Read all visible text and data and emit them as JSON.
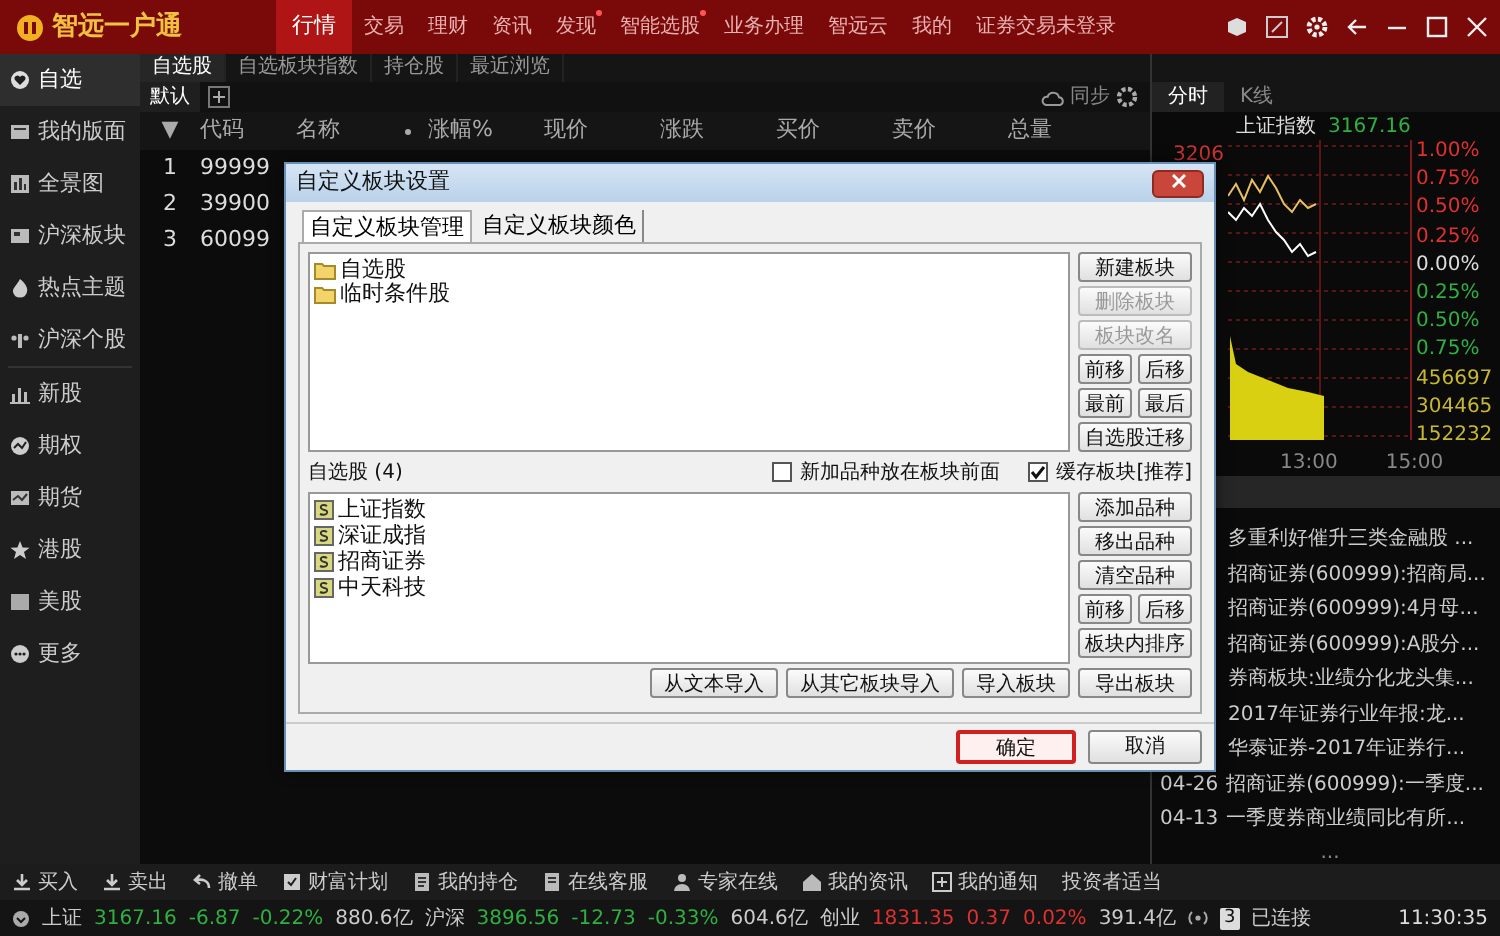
{
  "app": {
    "logo": "智远一户通"
  },
  "top_nav": [
    {
      "label": "行情",
      "selected": true,
      "dot": false
    },
    {
      "label": "交易",
      "selected": false,
      "dot": false
    },
    {
      "label": "理财",
      "selected": false,
      "dot": false
    },
    {
      "label": "资讯",
      "selected": false,
      "dot": false
    },
    {
      "label": "发现",
      "selected": false,
      "dot": true
    },
    {
      "label": "智能选股",
      "selected": false,
      "dot": true
    },
    {
      "label": "业务办理",
      "selected": false,
      "dot": false
    },
    {
      "label": "智远云",
      "selected": false,
      "dot": false
    },
    {
      "label": "我的",
      "selected": false,
      "dot": false
    }
  ],
  "login_status": "证券交易未登录",
  "sidebar": [
    {
      "label": "自选",
      "selected": true
    },
    {
      "label": "我的版面",
      "selected": false
    },
    {
      "label": "全景图",
      "selected": false
    },
    {
      "label": "沪深板块",
      "selected": false
    },
    {
      "label": "热点主题",
      "selected": false
    },
    {
      "label": "沪深个股",
      "selected": false
    },
    {
      "label": "新股",
      "selected": false
    },
    {
      "label": "期权",
      "selected": false
    },
    {
      "label": "期货",
      "selected": false
    },
    {
      "label": "港股",
      "selected": false
    },
    {
      "label": "美股",
      "selected": false
    },
    {
      "label": "更多",
      "selected": false
    }
  ],
  "subtabs": [
    {
      "label": "自选股",
      "selected": true
    },
    {
      "label": "自选板块指数",
      "selected": false
    },
    {
      "label": "持仓股",
      "selected": false
    },
    {
      "label": "最近浏览",
      "selected": false
    }
  ],
  "group_tabs": [
    {
      "label": "默认",
      "selected": true
    }
  ],
  "sync_label": "同步",
  "table": {
    "sort_marker": "▼",
    "columns": [
      "代码",
      "名称",
      "涨幅%",
      "现价",
      "涨跌",
      "买价",
      "卖价",
      "总量"
    ],
    "rows": [
      {
        "index": "1",
        "code": "99999"
      },
      {
        "index": "2",
        "code": "39900"
      },
      {
        "index": "3",
        "code": "60099"
      }
    ]
  },
  "right_panel": {
    "tabs": [
      {
        "label": "分时",
        "selected": true
      },
      {
        "label": "K线",
        "selected": false
      }
    ],
    "chart": {
      "title": "上证指数",
      "price": "3167.16",
      "left_labels": [
        "3206"
      ],
      "right_labels": [
        {
          "text": "1.00%",
          "kind": "up"
        },
        {
          "text": "0.75%",
          "kind": "up"
        },
        {
          "text": "0.50%",
          "kind": "up"
        },
        {
          "text": "0.25%",
          "kind": "up"
        },
        {
          "text": "0.00%",
          "kind": "flat"
        },
        {
          "text": "0.25%",
          "kind": "down"
        },
        {
          "text": "0.50%",
          "kind": "down"
        },
        {
          "text": "0.75%",
          "kind": "down"
        },
        {
          "text": "456697",
          "kind": "volume"
        },
        {
          "text": "304465",
          "kind": "volume"
        },
        {
          "text": "152232",
          "kind": "volume"
        }
      ],
      "time_labels": [
        "13:00",
        "15:00"
      ]
    },
    "news": [
      {
        "title": "多重利好催升三类金融股 ..."
      },
      {
        "title": "招商证券(600999):招商局..."
      },
      {
        "title": "招商证券(600999):4月母..."
      },
      {
        "title": "招商证券(600999):A股分..."
      },
      {
        "title": "券商板块:业绩分化龙头集..."
      },
      {
        "title": "2017年证券行业年报:龙..."
      },
      {
        "title": "华泰证券-2017年证券行..."
      },
      {
        "date": "04-26",
        "title": "招商证券(600999):一季度..."
      },
      {
        "date": "04-13",
        "title": "一季度券商业绩同比有所..."
      }
    ],
    "news_more": "..."
  },
  "toolbar": [
    "买入",
    "卖出",
    "撤单",
    "财富计划",
    "我的持仓",
    "在线客服",
    "专家在线",
    "我的资讯",
    "我的通知",
    "投资者适当"
  ],
  "status_bar": {
    "quotes": [
      {
        "text": "上证",
        "kind": "label"
      },
      {
        "text": "3167.16",
        "kind": "down"
      },
      {
        "text": "-6.87",
        "kind": "down"
      },
      {
        "text": "-0.22%",
        "kind": "down"
      },
      {
        "text": "880.6亿",
        "kind": "plain"
      },
      {
        "text": "沪深",
        "kind": "label"
      },
      {
        "text": "3896.56",
        "kind": "down"
      },
      {
        "text": "-12.73",
        "kind": "down"
      },
      {
        "text": "-0.33%",
        "kind": "down"
      },
      {
        "text": "604.6亿",
        "kind": "plain"
      },
      {
        "text": "创业",
        "kind": "label"
      },
      {
        "text": "1831.35",
        "kind": "up"
      },
      {
        "text": "0.37",
        "kind": "up"
      },
      {
        "text": "0.02%",
        "kind": "up"
      },
      {
        "text": "391.4亿",
        "kind": "plain"
      }
    ],
    "connections": "3",
    "connection_status": "已连接",
    "time": "11:30:35"
  },
  "dialog": {
    "title": "自定义板块设置",
    "tabs": [
      {
        "label": "自定义板块管理",
        "selected": true
      },
      {
        "label": "自定义板块颜色",
        "selected": false
      }
    ],
    "blocks": [
      "自选股",
      "临时条件股"
    ],
    "block_button_rows": [
      [
        {
          "label": "新建板块",
          "disabled": false
        }
      ],
      [
        {
          "label": "删除板块",
          "disabled": true
        }
      ],
      [
        {
          "label": "板块改名",
          "disabled": true
        }
      ],
      [
        {
          "label": "前移",
          "disabled": false
        },
        {
          "label": "后移",
          "disabled": false
        }
      ],
      [
        {
          "label": "最前",
          "disabled": false
        },
        {
          "label": "最后",
          "disabled": false
        }
      ],
      [
        {
          "label": "自选股迁移",
          "disabled": false
        }
      ]
    ],
    "list_label": "自选股 (4)",
    "options": [
      {
        "label": "新加品种放在板块前面",
        "checked": false
      },
      {
        "label": "缓存板块[推荐]",
        "checked": true
      }
    ],
    "stocks": [
      "上证指数",
      "深证成指",
      "招商证券",
      "中天科技"
    ],
    "stock_button_rows": [
      [
        {
          "label": "添加品种",
          "disabled": false
        }
      ],
      [
        {
          "label": "移出品种",
          "disabled": false
        }
      ],
      [
        {
          "label": "清空品种",
          "disabled": false
        }
      ],
      [
        {
          "label": "前移",
          "disabled": false
        },
        {
          "label": "后移",
          "disabled": false
        }
      ],
      [
        {
          "label": "板块内排序",
          "disabled": false
        }
      ]
    ],
    "import_buttons": [
      "从文本导入",
      "从其它板块导入",
      "导入板块"
    ],
    "export_button": "导出板块",
    "footer_buttons": [
      {
        "label": "确定",
        "highlighted": true
      },
      {
        "label": "取消",
        "highlighted": false
      }
    ]
  }
}
